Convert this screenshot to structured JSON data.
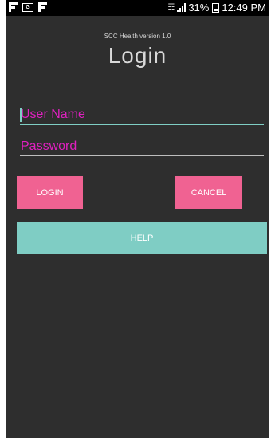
{
  "status_bar": {
    "notif_icons": [
      "flipboard-icon",
      "gmail-icon",
      "flipboard-icon"
    ],
    "box_icon_text": "G",
    "battery": "31%",
    "time": "12:49 PM"
  },
  "app": {
    "version": "SCC Health version 1.0",
    "title": "Login"
  },
  "form": {
    "username_placeholder": "User Name",
    "username_value": "",
    "password_placeholder": "Password",
    "password_value": ""
  },
  "buttons": {
    "login": "LOGIN",
    "cancel": "CANCEL",
    "help": "HELP"
  },
  "colors": {
    "background": "#2e2e2e",
    "accent_pink": "#f06292",
    "accent_teal": "#7fcdc4",
    "hint_magenta": "#e020c0"
  }
}
